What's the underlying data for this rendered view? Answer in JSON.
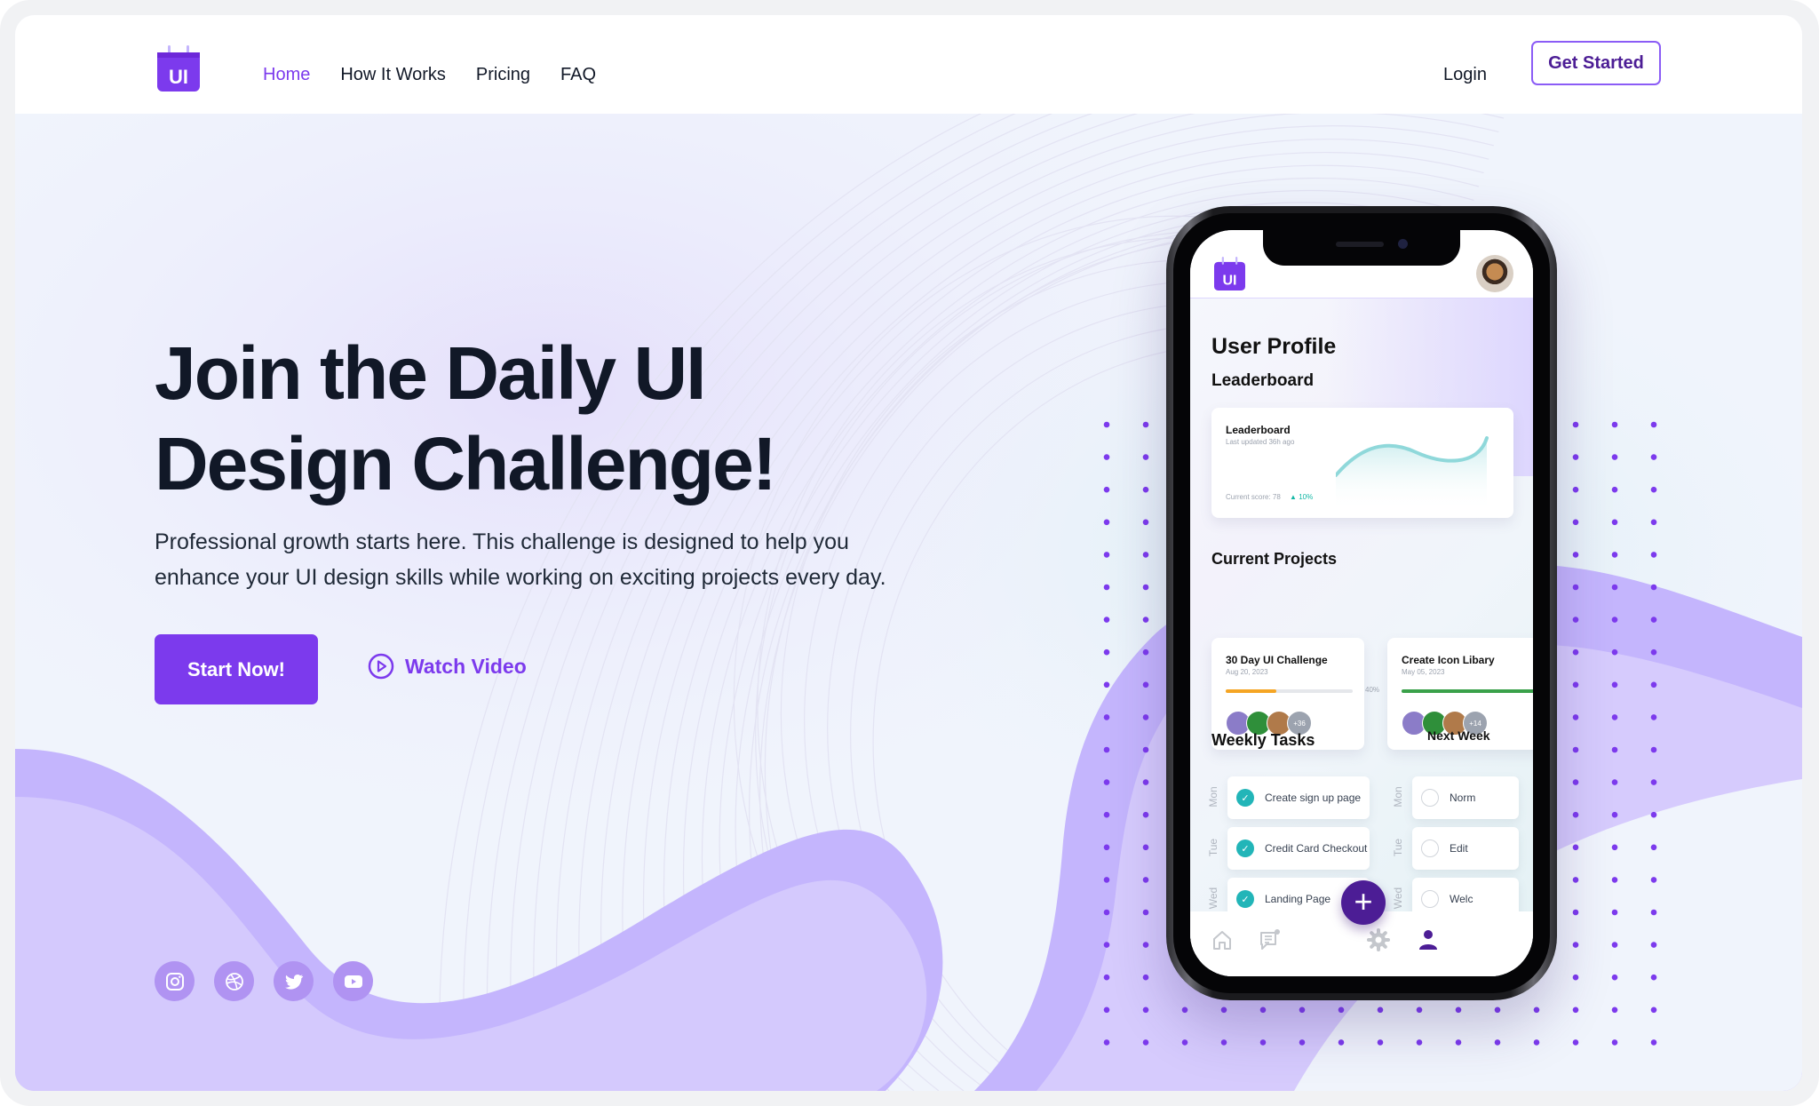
{
  "header": {
    "logo_text": "UI",
    "nav": [
      {
        "label": "Home",
        "active": true
      },
      {
        "label": "How It Works",
        "active": false
      },
      {
        "label": "Pricing",
        "active": false
      },
      {
        "label": "FAQ",
        "active": false
      }
    ],
    "login_label": "Login",
    "get_started_label": "Get Started"
  },
  "hero": {
    "title_line1": "Join the Daily UI",
    "title_line2": "Design Challenge!",
    "lead_line1": "Professional growth starts here. This challenge is designed to help you",
    "lead_line2": "enhance your UI design skills while working on exciting projects every day.",
    "start_label": "Start Now!",
    "watch_label": "Watch Video"
  },
  "socials": [
    {
      "icon": "instagram-icon"
    },
    {
      "icon": "dribbble-icon"
    },
    {
      "icon": "twitter-icon"
    },
    {
      "icon": "youtube-icon"
    }
  ],
  "phone": {
    "logo_text": "UI",
    "page_title": "User Profile",
    "leaderboard_heading": "Leaderboard",
    "leaderboard_card": {
      "title": "Leaderboard",
      "updated": "Last updated 36h ago",
      "score": "Current score: 78",
      "change": "10%"
    },
    "projects_heading": "Current Projects",
    "projects": [
      {
        "title": "30 Day UI Challenge",
        "date": "Aug 20, 2023",
        "progress": 0.4,
        "progress_label": "40%",
        "extra_members": "+36",
        "color": "#f5a524"
      },
      {
        "title": "Create Icon Libary",
        "date": "May 05, 2023",
        "progress": 1.0,
        "progress_label": "",
        "extra_members": "+14",
        "color": "#3aa14a"
      }
    ],
    "weekly_heading": "Weekly Tasks",
    "next_week_heading": "Next Week",
    "weekly_tasks": [
      {
        "day": "Mon",
        "label": "Create sign up page",
        "done": true
      },
      {
        "day": "Tue",
        "label": "Credit Card Checkout",
        "done": true
      },
      {
        "day": "Wed",
        "label": "Landing Page",
        "done": true
      }
    ],
    "next_week_tasks": [
      {
        "day": "Mon",
        "label": "Norm",
        "done": false
      },
      {
        "day": "Tue",
        "label": "Edit",
        "done": false
      },
      {
        "day": "Wed",
        "label": "Welc",
        "done": false
      }
    ],
    "fab_label": "+"
  },
  "colors": {
    "accent": "#7c3aed",
    "accent_dark": "#4c1d95",
    "wave_dark": "#c4b5fd",
    "wave_light": "#d6cbfd",
    "dot": "#7c3aed",
    "teal": "#22b5b8"
  }
}
